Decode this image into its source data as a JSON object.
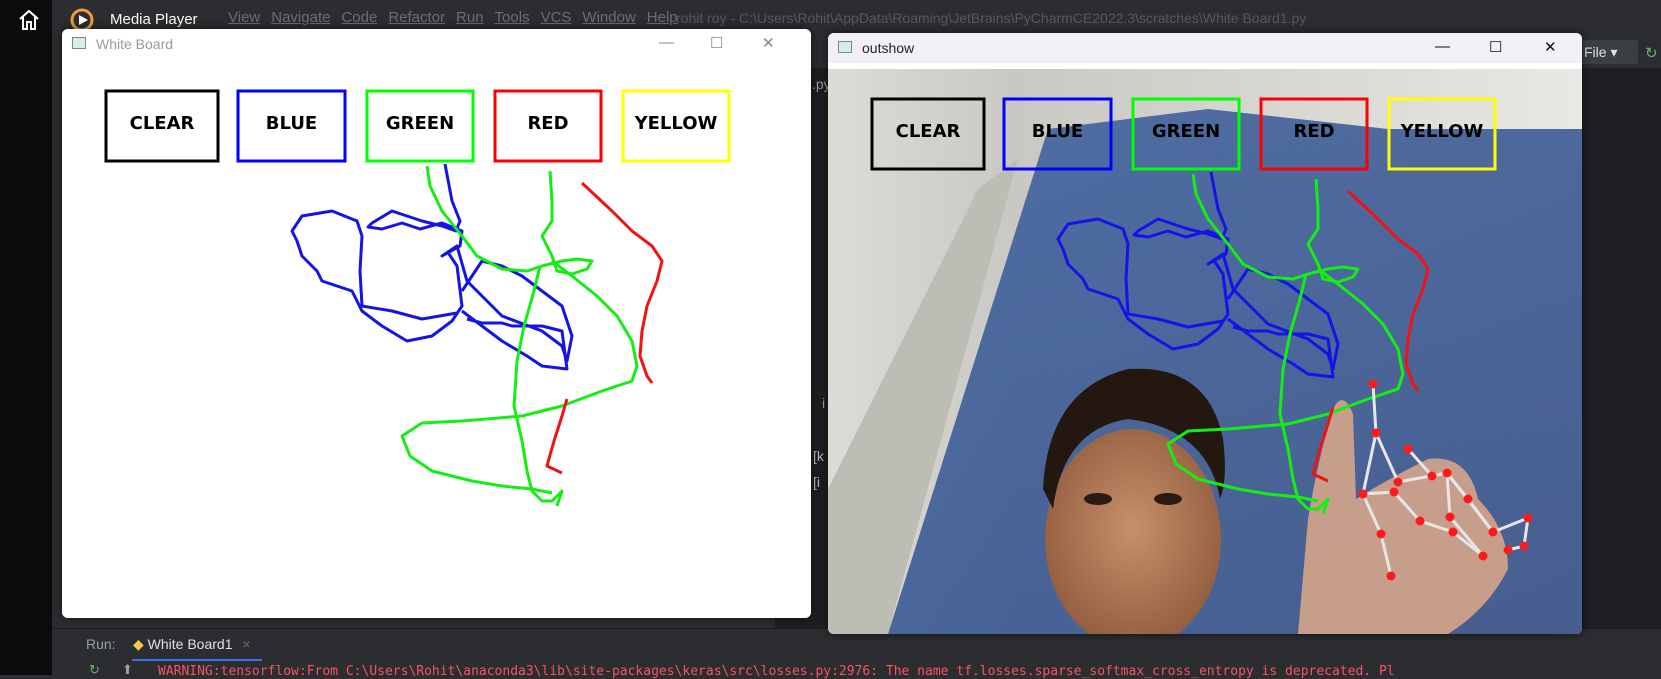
{
  "taskbar": {
    "app_title": "Media Player"
  },
  "ide": {
    "menu": [
      "View",
      "Navigate",
      "Code",
      "Refactor",
      "Run",
      "Tools",
      "VCS",
      "Window",
      "Help"
    ],
    "path": "rohit roy - C:\\Users\\Rohit\\AppData\\Roaming\\JetBrains\\PyCharmCE2022.3\\scratches\\White Board1.py",
    "tab_fragment": ".py",
    "file_button": "File",
    "code_i": "i",
    "code_k": "[k",
    "code_i2": "[i",
    "run_label": "Run:",
    "run_tab": "White Board1",
    "run_tab_close": "×",
    "warning": "WARNING:tensorflow:From C:\\Users\\Rohit\\anaconda3\\lib\\site-packages\\keras\\src\\losses.py:2976: The name tf.losses.sparse_softmax_cross_entropy is deprecated. Pl"
  },
  "whiteboard_window": {
    "title": "White Board",
    "minimize": "—",
    "maximize": "☐",
    "close": "✕"
  },
  "outshow_window": {
    "title": "outshow",
    "minimize": "—",
    "maximize": "☐",
    "close": "✕"
  },
  "color_buttons": [
    {
      "label": "CLEAR",
      "color": "#000000"
    },
    {
      "label": "BLUE",
      "color": "#0000ff"
    },
    {
      "label": "GREEN",
      "color": "#00ff00"
    },
    {
      "label": "RED",
      "color": "#ff0000"
    },
    {
      "label": "YELLOW",
      "color": "#ffff00"
    }
  ],
  "colors": {
    "blue_stroke": "#1414e6",
    "green_stroke": "#14ee14",
    "red_stroke": "#ee1414",
    "landmark": "#ff1a1a",
    "skeleton": "#e6e6e6"
  }
}
